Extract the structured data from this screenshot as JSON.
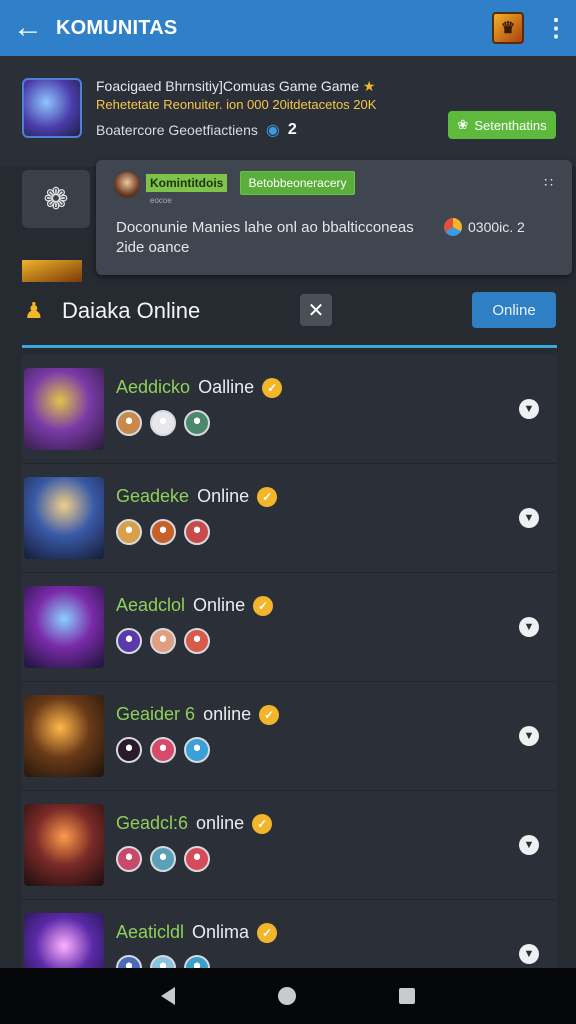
{
  "appbar": {
    "title": "KOMUNITAS",
    "back_icon": "arrow-left-icon",
    "badge_icon": "game-badge-icon",
    "more_icon": "more-vertical-icon"
  },
  "group": {
    "title": "Foacigaed Bhrnsitiy]Comuas Game Game",
    "subtitle": "Rehetetate Reonuiter. ion 000 20itdetacetos 20K",
    "meta": "Boatercore Geoetfiactiens",
    "count": "2",
    "join_label": "Setenthatins"
  },
  "notification": {
    "name": "Komintitdois",
    "small": "eocoe",
    "tag": "Betobbeoneracery",
    "body": "Doconunie Manies lahe onl ao bbalticconeas 2ide oance",
    "stat": "0300ic. 2"
  },
  "online_section": {
    "title": "Daiaka Online",
    "button_label": "Online"
  },
  "members": [
    {
      "name": "Aeddicko",
      "suffix": "Oalline"
    },
    {
      "name": "Geadeke",
      "suffix": "Online"
    },
    {
      "name": "Aeadclol",
      "suffix": "Online"
    },
    {
      "name": "Geaider 6",
      "suffix": "online"
    },
    {
      "name": "Geadcl:6",
      "suffix": "online"
    },
    {
      "name": "Aeaticldl",
      "suffix": "Onlima"
    }
  ],
  "colors": {
    "accent_blue": "#2f80c8",
    "online_green": "#8ed05a",
    "join_green": "#5dba3c",
    "verified_gold": "#f3b52a",
    "background": "#262b32"
  }
}
